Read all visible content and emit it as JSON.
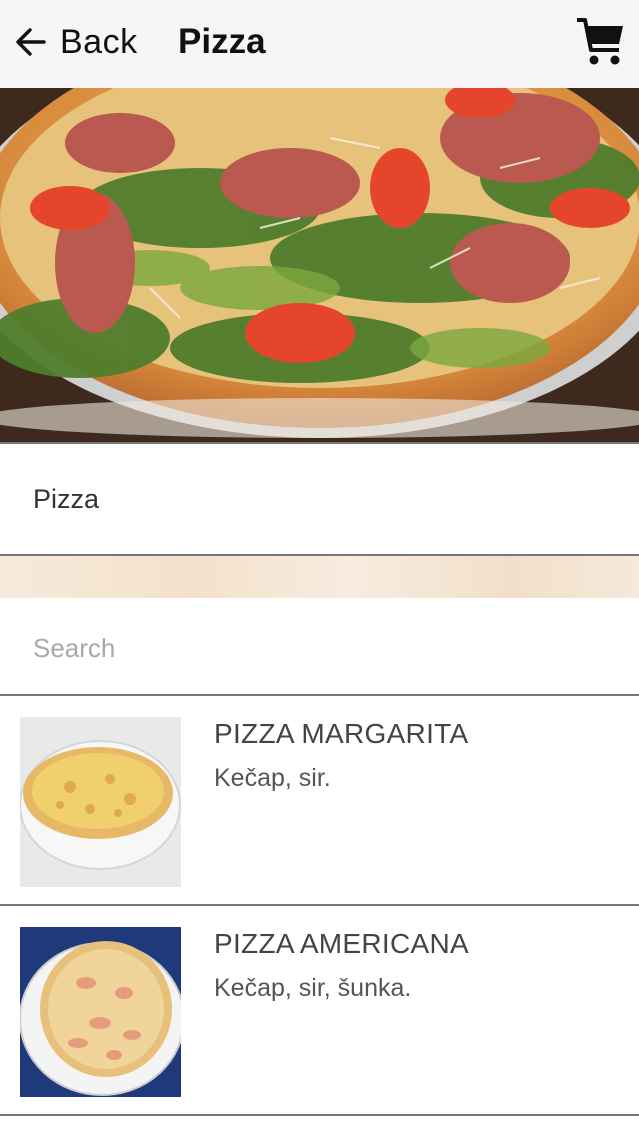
{
  "header": {
    "back_label": "Back",
    "title": "Pizza",
    "icons": {
      "back": "arrow-left-icon",
      "cart": "shopping-cart-icon"
    }
  },
  "hero": {
    "image": "pizza-prosciutto-arugula-photo"
  },
  "category": {
    "label": "Pizza"
  },
  "search": {
    "placeholder": "Search",
    "value": ""
  },
  "menu_items": [
    {
      "name": "PIZZA MARGARITA",
      "description": "Kečap, sir.",
      "image": "pizza-margarita-photo"
    },
    {
      "name": "PIZZA AMERICANA",
      "description": "Kečap, sir, šunka.",
      "image": "pizza-americana-photo"
    }
  ],
  "colors": {
    "header_bg": "#f6f5f7",
    "divider": "#777777",
    "parchment": "#f4e4d0",
    "text": "#333333"
  }
}
